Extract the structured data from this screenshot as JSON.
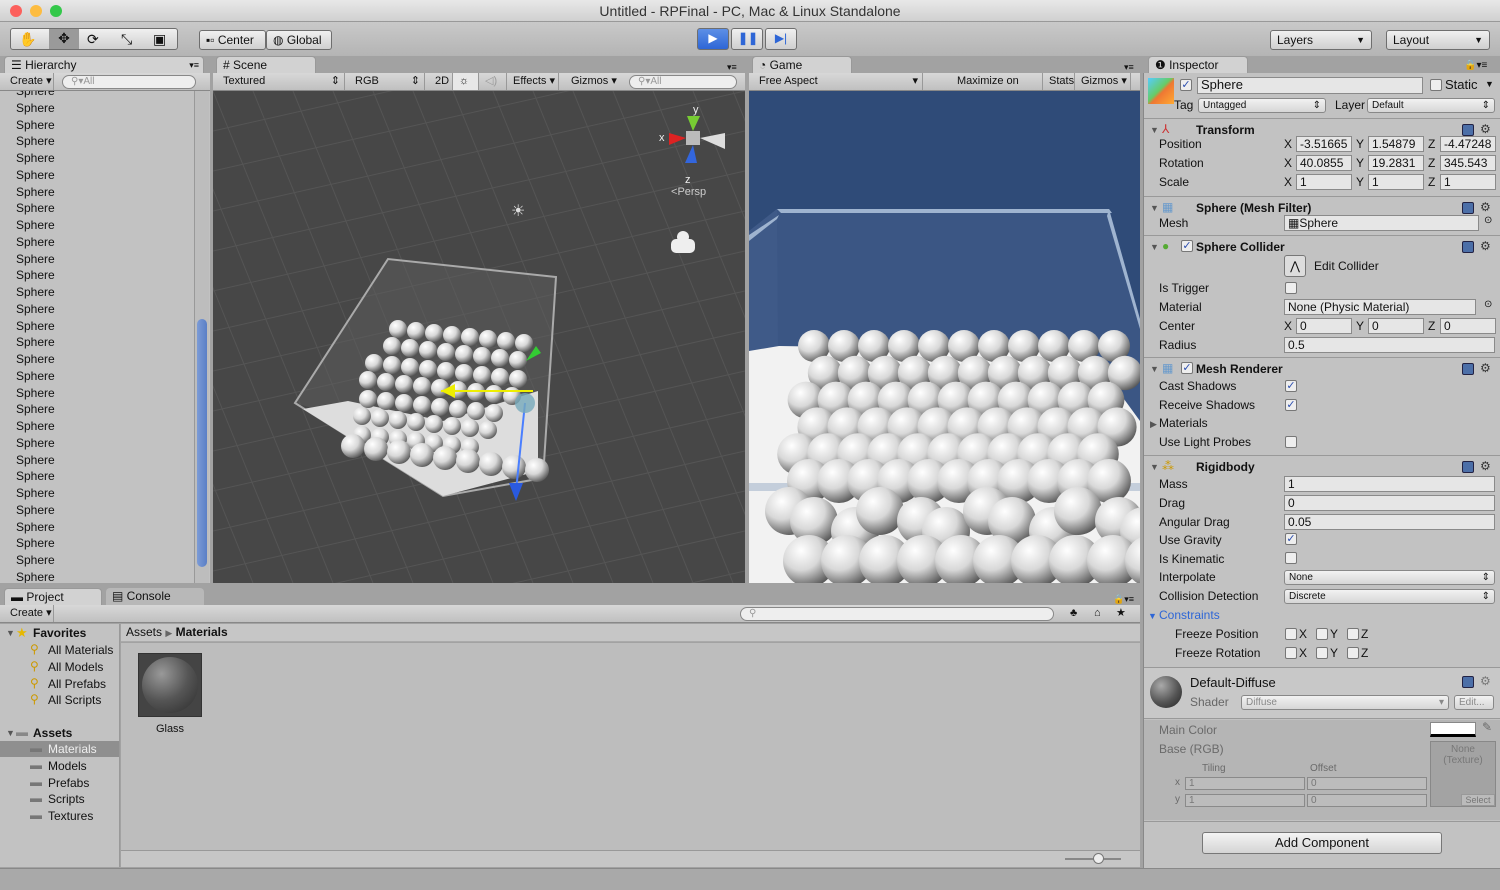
{
  "window": {
    "title": "Untitled - RPFinal - PC, Mac & Linux Standalone"
  },
  "toolbar": {
    "pivot": "Center",
    "space": "Global",
    "layers": "Layers",
    "layout": "Layout",
    "tools": [
      "hand-tool",
      "move-tool",
      "rotate-tool",
      "scale-tool",
      "rect-tool"
    ],
    "play": "play",
    "pause": "pause",
    "step": "step"
  },
  "hierarchy": {
    "tab": "Hierarchy",
    "create": "Create",
    "search_placeholder": "All",
    "items": [
      "Sphere",
      "Sphere",
      "Sphere",
      "Sphere",
      "Sphere",
      "Sphere",
      "Sphere",
      "Sphere",
      "Sphere",
      "Sphere",
      "Sphere",
      "Sphere",
      "Sphere",
      "Sphere",
      "Sphere",
      "Sphere",
      "Sphere",
      "Sphere",
      "Sphere",
      "Sphere",
      "Sphere",
      "Sphere",
      "Sphere",
      "Sphere",
      "Sphere",
      "Sphere",
      "Sphere",
      "Sphere",
      "Sphere",
      "Sphere"
    ]
  },
  "scene": {
    "tab": "Scene",
    "shading": "Textured",
    "channel": "RGB",
    "mode2d": "2D",
    "effects": "Effects",
    "gizmos": "Gizmos",
    "search_placeholder": "All",
    "gizmo_labels": {
      "x": "x",
      "y": "y",
      "z": "z",
      "persp": "Persp"
    }
  },
  "game": {
    "tab": "Game",
    "aspect": "Free Aspect",
    "maximize": "Maximize on Play",
    "stats": "Stats",
    "gizmos": "Gizmos"
  },
  "project": {
    "tab": "Project",
    "console_tab": "Console",
    "create": "Create",
    "favorites_label": "Favorites",
    "favorites": [
      "All Materials",
      "All Models",
      "All Prefabs",
      "All Scripts"
    ],
    "assets_label": "Assets",
    "folders": [
      "Materials",
      "Models",
      "Prefabs",
      "Scripts",
      "Textures"
    ],
    "selected_folder": "Materials",
    "breadcrumb": [
      "Assets",
      "Materials"
    ],
    "files": [
      {
        "name": "Glass"
      }
    ]
  },
  "inspector": {
    "tab": "Inspector",
    "object_name": "Sphere",
    "static_label": "Static",
    "tag_label": "Tag",
    "tag": "Untagged",
    "layer_label": "Layer",
    "layer": "Default",
    "transform": {
      "title": "Transform",
      "rows": [
        {
          "label": "Position",
          "x": "-3.51665",
          "y": "1.54879",
          "z": "-4.47248"
        },
        {
          "label": "Rotation",
          "x": "40.0855",
          "y": "19.2831",
          "z": "345.543"
        },
        {
          "label": "Scale",
          "x": "1",
          "y": "1",
          "z": "1"
        }
      ]
    },
    "mesh_filter": {
      "title": "Sphere (Mesh Filter)",
      "mesh_label": "Mesh",
      "mesh": "Sphere"
    },
    "sphere_collider": {
      "title": "Sphere Collider",
      "edit": "Edit Collider",
      "is_trigger_label": "Is Trigger",
      "is_trigger": false,
      "material_label": "Material",
      "material": "None (Physic Material)",
      "center_label": "Center",
      "center": {
        "x": "0",
        "y": "0",
        "z": "0"
      },
      "radius_label": "Radius",
      "radius": "0.5"
    },
    "mesh_renderer": {
      "title": "Mesh Renderer",
      "cast_shadows_label": "Cast Shadows",
      "cast_shadows": true,
      "receive_shadows_label": "Receive Shadows",
      "receive_shadows": true,
      "materials_label": "Materials",
      "light_probes_label": "Use Light Probes",
      "light_probes": false
    },
    "rigidbody": {
      "title": "Rigidbody",
      "mass_label": "Mass",
      "mass": "1",
      "drag_label": "Drag",
      "drag": "0",
      "angular_drag_label": "Angular Drag",
      "angular_drag": "0.05",
      "use_gravity_label": "Use Gravity",
      "use_gravity": true,
      "is_kinematic_label": "Is Kinematic",
      "is_kinematic": false,
      "interpolate_label": "Interpolate",
      "interpolate": "None",
      "collision_label": "Collision Detection",
      "collision": "Discrete",
      "constraints_label": "Constraints",
      "freeze_position_label": "Freeze Position",
      "freeze_rotation_label": "Freeze Rotation",
      "axes": [
        "X",
        "Y",
        "Z"
      ]
    },
    "material": {
      "name": "Default-Diffuse",
      "shader_label": "Shader",
      "shader": "Diffuse",
      "edit": "Edit...",
      "main_color_label": "Main Color",
      "main_color": "#ffffff",
      "base_label": "Base (RGB)",
      "texture": "None (Texture)",
      "select": "Select",
      "tiling_label": "Tiling",
      "offset_label": "Offset",
      "tiling": {
        "x": "1",
        "y": "1"
      },
      "offset": {
        "x": "0",
        "y": "0"
      },
      "x_label": "x",
      "y_label": "y"
    },
    "add_component": "Add Component"
  },
  "colors": {
    "game_sky": "#2f4b78",
    "scene_bg": "#474747",
    "accent": "#2e66d6"
  }
}
